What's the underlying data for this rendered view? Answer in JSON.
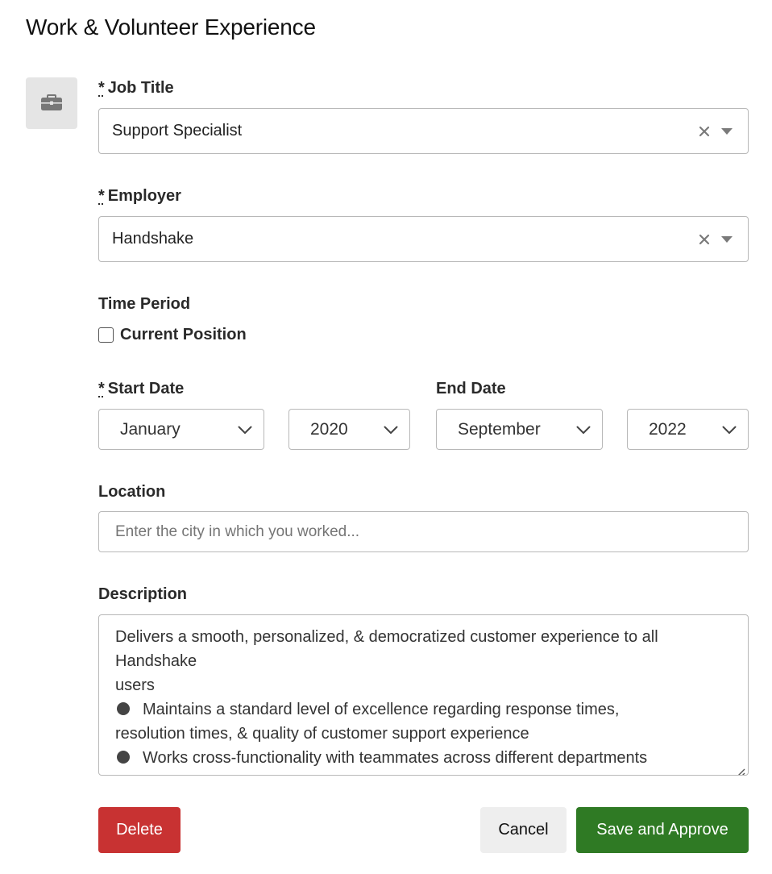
{
  "page": {
    "title": "Work & Volunteer Experience"
  },
  "icons": {
    "section": "briefcase-icon",
    "clear": "close-icon",
    "caret": "triangle-down-icon",
    "select_caret": "chevron-down-icon"
  },
  "job_title": {
    "required_mark": "*",
    "label": "Job Title",
    "value": "Support Specialist"
  },
  "employer": {
    "required_mark": "*",
    "label": "Employer",
    "value": "Handshake"
  },
  "time_period": {
    "label": "Time Period",
    "current_position_label": "Current Position",
    "current_position_checked": false,
    "start": {
      "required_mark": "*",
      "label": "Start Date",
      "month": "January",
      "year": "2020"
    },
    "end": {
      "label": "End Date",
      "month": "September",
      "year": "2022"
    }
  },
  "location": {
    "label": "Location",
    "value": "",
    "placeholder": "Enter the city in which you worked..."
  },
  "description": {
    "label": "Description",
    "lines": [
      "Delivers a smooth, personalized, & democratized customer experience to all",
      "Handshake",
      "users",
      "Maintains a standard level of excellence regarding response times,",
      "resolution times, & quality of customer support experience",
      "Works cross-functionality with teammates across different departments"
    ]
  },
  "actions": {
    "delete_label": "Delete",
    "cancel_label": "Cancel",
    "save_label": "Save and Approve"
  },
  "colors": {
    "delete": "#c83232",
    "save": "#2f7a24",
    "cancel": "#eeeeee",
    "icon_tile": "#e5e5e5"
  }
}
